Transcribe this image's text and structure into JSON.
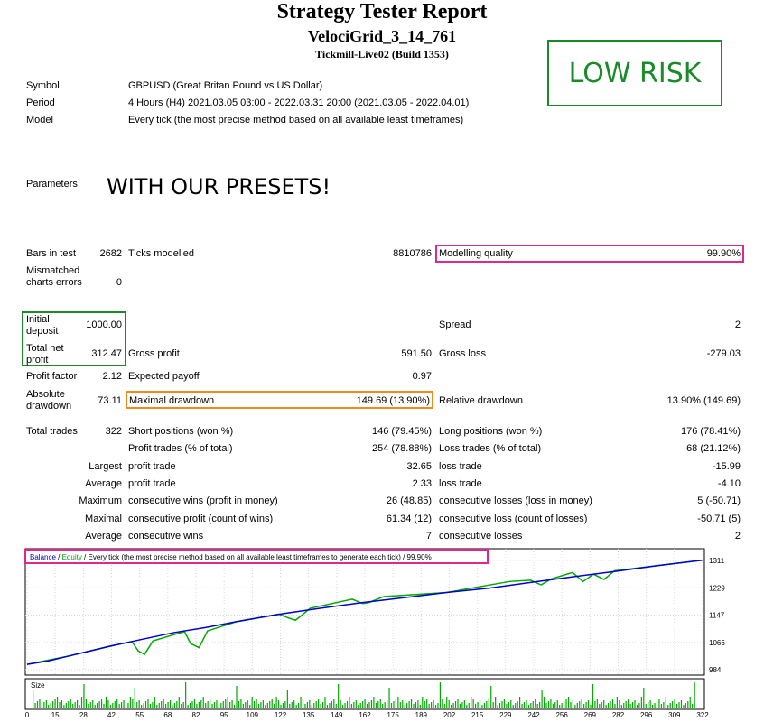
{
  "report": {
    "title": "Strategy Tester Report",
    "ea_name": "VelociGrid_3_14_761",
    "server": "Tickmill-Live02 (Build 1353)"
  },
  "badge": {
    "label": "LOW RISK",
    "color": "#1b8a2a"
  },
  "overlay_text": "WITH OUR PRESETS!",
  "header": {
    "symbol_label": "Symbol",
    "symbol_value": "GBPUSD (Great Britan Pound vs US Dollar)",
    "period_label": "Period",
    "period_value": "4 Hours (H4) 2021.03.05 03:00 - 2022.03.31 20:00 (2021.03.05 - 2022.04.01)",
    "model_label": "Model",
    "model_value": "Every tick (the most precise method based on all available least timeframes)",
    "parameters_label": "Parameters"
  },
  "stats": {
    "bars_label": "Bars in test",
    "bars_value": "2682",
    "ticks_label": "Ticks modelled",
    "ticks_value": "8810786",
    "quality_label": "Modelling quality",
    "quality_value": "99.90%",
    "mismatch_label": "Mismatched charts errors",
    "mismatch_value": "0",
    "deposit_label": "Initial deposit",
    "deposit_value": "1000.00",
    "spread_label": "Spread",
    "spread_value": "2",
    "netprofit_label": "Total net profit",
    "netprofit_value": "312.47",
    "grossprofit_label": "Gross profit",
    "grossprofit_value": "591.50",
    "grossloss_label": "Gross loss",
    "grossloss_value": "-279.03",
    "pf_label": "Profit factor",
    "pf_value": "2.12",
    "payoff_label": "Expected payoff",
    "payoff_value": "0.97",
    "absdd_label": "Absolute drawdown",
    "absdd_value": "73.11",
    "maxdd_label": "Maximal drawdown",
    "maxdd_value": "149.69 (13.90%)",
    "reldd_label": "Relative drawdown",
    "reldd_value": "13.90% (149.69)",
    "trades_label": "Total trades",
    "trades_value": "322",
    "short_label": "Short positions (won %)",
    "short_value": "146 (79.45%)",
    "long_label": "Long positions (won %)",
    "long_value": "176 (78.41%)",
    "profittrades_label": "Profit trades (% of total)",
    "profittrades_value": "254 (78.88%)",
    "losstrades_label": "Loss trades (% of total)",
    "losstrades_value": "68 (21.12%)",
    "largest_label": "Largest",
    "largest_profit_label": "profit trade",
    "largest_profit_value": "32.65",
    "largest_loss_label": "loss trade",
    "largest_loss_value": "-15.99",
    "average_label": "Average",
    "average_profit_label": "profit trade",
    "average_profit_value": "2.33",
    "average_loss_label": "loss trade",
    "average_loss_value": "-4.10",
    "maximum_label": "Maximum",
    "max_wins_label": "consecutive wins (profit in money)",
    "max_wins_value": "26 (48.85)",
    "max_losses_label": "consecutive losses (loss in money)",
    "max_losses_value": "5 (-50.71)",
    "maximal_label": "Maximal",
    "maximal_profit_label": "consecutive profit (count of wins)",
    "maximal_profit_value": "61.34 (12)",
    "maximal_loss_label": "consecutive loss (count of losses)",
    "maximal_loss_value": "-50.71 (5)",
    "avgcons_label": "Average",
    "avgcons_wins_label": "consecutive wins",
    "avgcons_wins_value": "7",
    "avgcons_losses_label": "consecutive losses",
    "avgcons_losses_value": "2"
  },
  "chart_legend": {
    "balance": "Balance",
    "sep1": " / ",
    "equity": "Equity",
    "rest": " / Every tick (the most precise method based on all available least timeframes to generate each tick)",
    "quality": " / 99.90%"
  },
  "colors": {
    "balance": "#0000cc",
    "equity": "#00aa00",
    "volume": "#00aa00",
    "pink": "#e0278a",
    "orange": "#f08a1c"
  },
  "chart_data": {
    "type": "line",
    "title": "",
    "ylim": [
      984,
      1311
    ],
    "y_ticks": [
      "1311",
      "1229",
      "1147",
      "1066",
      "984"
    ],
    "x_ticks": [
      "0",
      "15",
      "28",
      "42",
      "55",
      "68",
      "82",
      "95",
      "109",
      "122",
      "135",
      "149",
      "162",
      "175",
      "189",
      "202",
      "215",
      "229",
      "242",
      "256",
      "269",
      "282",
      "296",
      "309",
      "322"
    ],
    "size_label": "Size",
    "series": [
      {
        "name": "Balance",
        "x": [
          0,
          10,
          20,
          30,
          40,
          55,
          70,
          85,
          100,
          120,
          140,
          160,
          180,
          200,
          220,
          240,
          260,
          280,
          300,
          322
        ],
        "y": [
          1000,
          1010,
          1025,
          1040,
          1055,
          1075,
          1095,
          1110,
          1128,
          1150,
          1168,
          1185,
          1200,
          1215,
          1228,
          1245,
          1262,
          1278,
          1295,
          1312
        ]
      },
      {
        "name": "Equity",
        "x": [
          0,
          20,
          40,
          50,
          53,
          56,
          60,
          75,
          78,
          82,
          86,
          100,
          120,
          125,
          128,
          135,
          155,
          160,
          163,
          170,
          200,
          230,
          240,
          245,
          250,
          260,
          265,
          270,
          275,
          280,
          300,
          322
        ],
        "y": [
          1000,
          1025,
          1055,
          1068,
          1040,
          1030,
          1070,
          1098,
          1062,
          1050,
          1100,
          1128,
          1150,
          1138,
          1132,
          1168,
          1195,
          1182,
          1185,
          1203,
          1215,
          1248,
          1252,
          1238,
          1256,
          1275,
          1248,
          1270,
          1254,
          1280,
          1295,
          1312
        ]
      }
    ]
  }
}
